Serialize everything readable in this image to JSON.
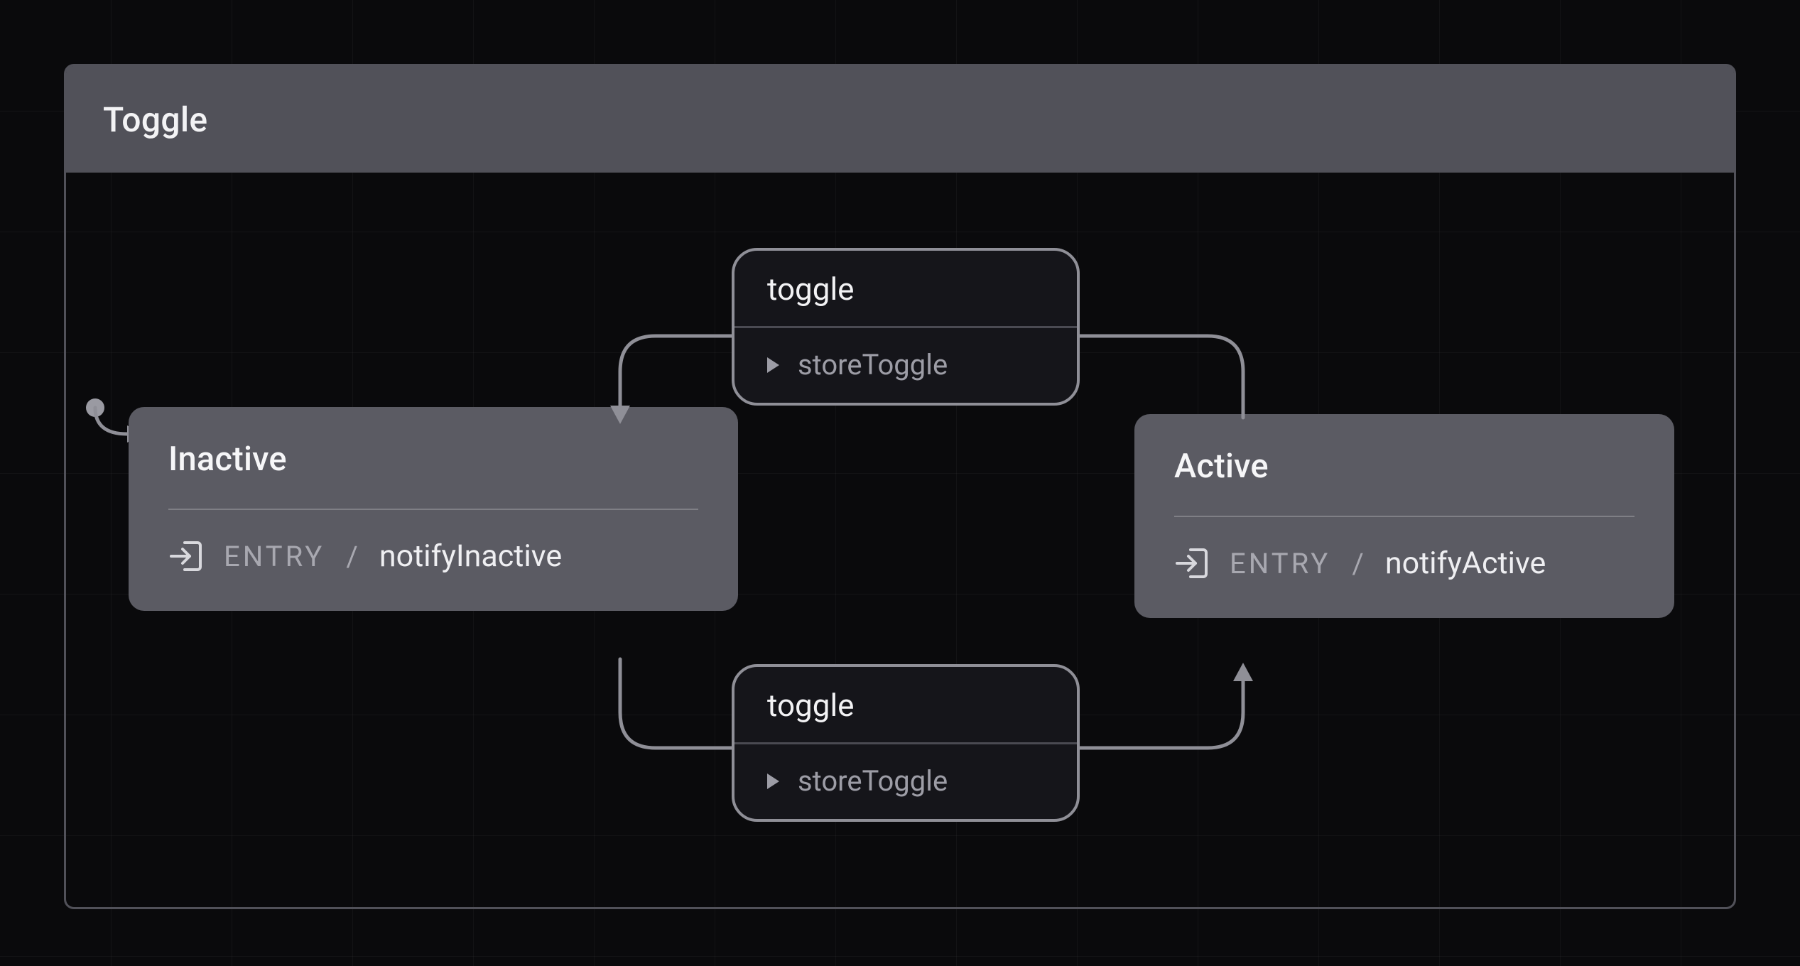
{
  "machine": {
    "title": "Toggle"
  },
  "states": {
    "inactive": {
      "name": "Inactive",
      "entry_keyword": "ENTRY",
      "entry_action": "notifyInactive"
    },
    "active": {
      "name": "Active",
      "entry_keyword": "ENTRY",
      "entry_action": "notifyActive"
    }
  },
  "transitions": {
    "top": {
      "event": "toggle",
      "action": "storeToggle"
    },
    "bottom": {
      "event": "toggle",
      "action": "storeToggle"
    }
  }
}
